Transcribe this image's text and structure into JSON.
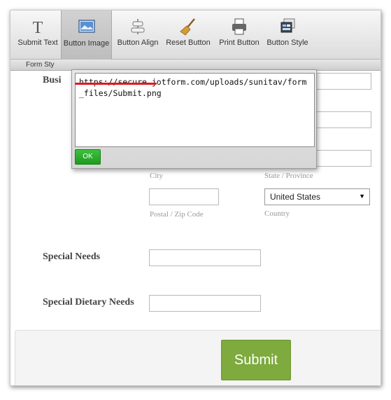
{
  "toolbar": {
    "buttons": [
      {
        "label": "Submit Text",
        "icon": "letter-t-icon"
      },
      {
        "label": "Button Image",
        "icon": "image-icon"
      },
      {
        "label": "Button Align",
        "icon": "align-icon"
      },
      {
        "label": "Reset Button",
        "icon": "broom-icon"
      },
      {
        "label": "Print Button",
        "icon": "printer-icon"
      },
      {
        "label": "Button Style",
        "icon": "style-icon"
      }
    ],
    "active_index": 1
  },
  "tabstrip": {
    "label": "Form Sty"
  },
  "popup": {
    "url": "https://secure.jotform.com/uploads/sunitav/form_files/Submit.png",
    "ok_label": "OK"
  },
  "form": {
    "business_label_fragment": "Busi",
    "city_label": "City",
    "state_label": "State / Province",
    "postal_label": "Postal / Zip Code",
    "country_label": "Country",
    "country_value": "United States",
    "special_needs_label": "Special Needs",
    "special_dietary_label": "Special Dietary Needs",
    "submit_label": "Submit"
  },
  "colors": {
    "submit": "#7eaa3e",
    "ok": "#2aa82a",
    "annotation": "#e0191f"
  }
}
